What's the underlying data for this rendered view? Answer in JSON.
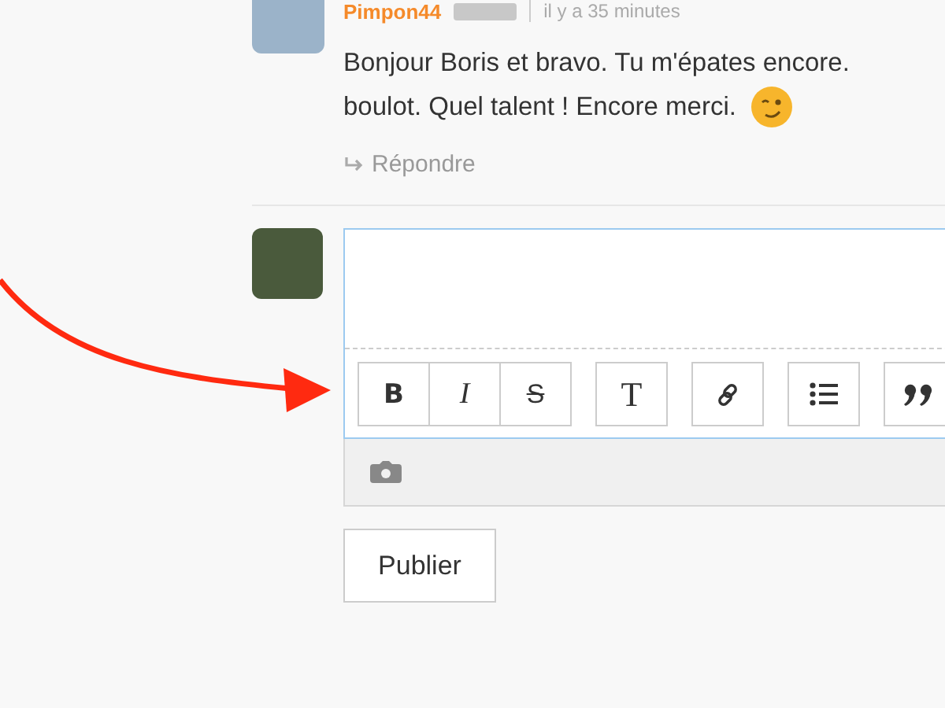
{
  "comment": {
    "author": "Pimpon44",
    "time": "il y a 35 minutes",
    "lines": [
      "Bonjour Boris et bravo. Tu m'épates encore.",
      "boulot. Quel talent ! Encore merci."
    ],
    "reply": "Répondre"
  },
  "editor": {
    "toolbar": [
      [
        {
          "kind": "bold",
          "label": "B"
        },
        {
          "kind": "italic",
          "label": "I"
        },
        {
          "kind": "strike",
          "label": "S"
        }
      ],
      [
        {
          "kind": "heading",
          "label": "T"
        }
      ],
      [
        {
          "kind": "link"
        }
      ],
      [
        {
          "kind": "list"
        }
      ],
      [
        {
          "kind": "quote"
        }
      ]
    ]
  },
  "publish_button": "Publier"
}
